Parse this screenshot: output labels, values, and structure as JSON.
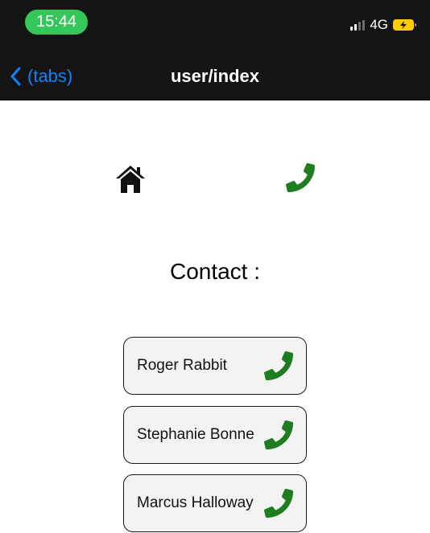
{
  "status_bar": {
    "time": "15:44",
    "network": "4G"
  },
  "nav": {
    "back_label": "(tabs)",
    "title": "user/index"
  },
  "icons": {
    "home": "home-icon",
    "phone": "phone-icon",
    "phone_color": "#1e7d1e"
  },
  "page": {
    "contact_title": "Contact :"
  },
  "contacts": [
    {
      "name": "Roger Rabbit"
    },
    {
      "name": "Stephanie Bonne"
    },
    {
      "name": "Marcus Halloway"
    }
  ],
  "colors": {
    "accent": "#0a84ff",
    "time_pill": "#34c759",
    "battery": "#ffcc00"
  }
}
